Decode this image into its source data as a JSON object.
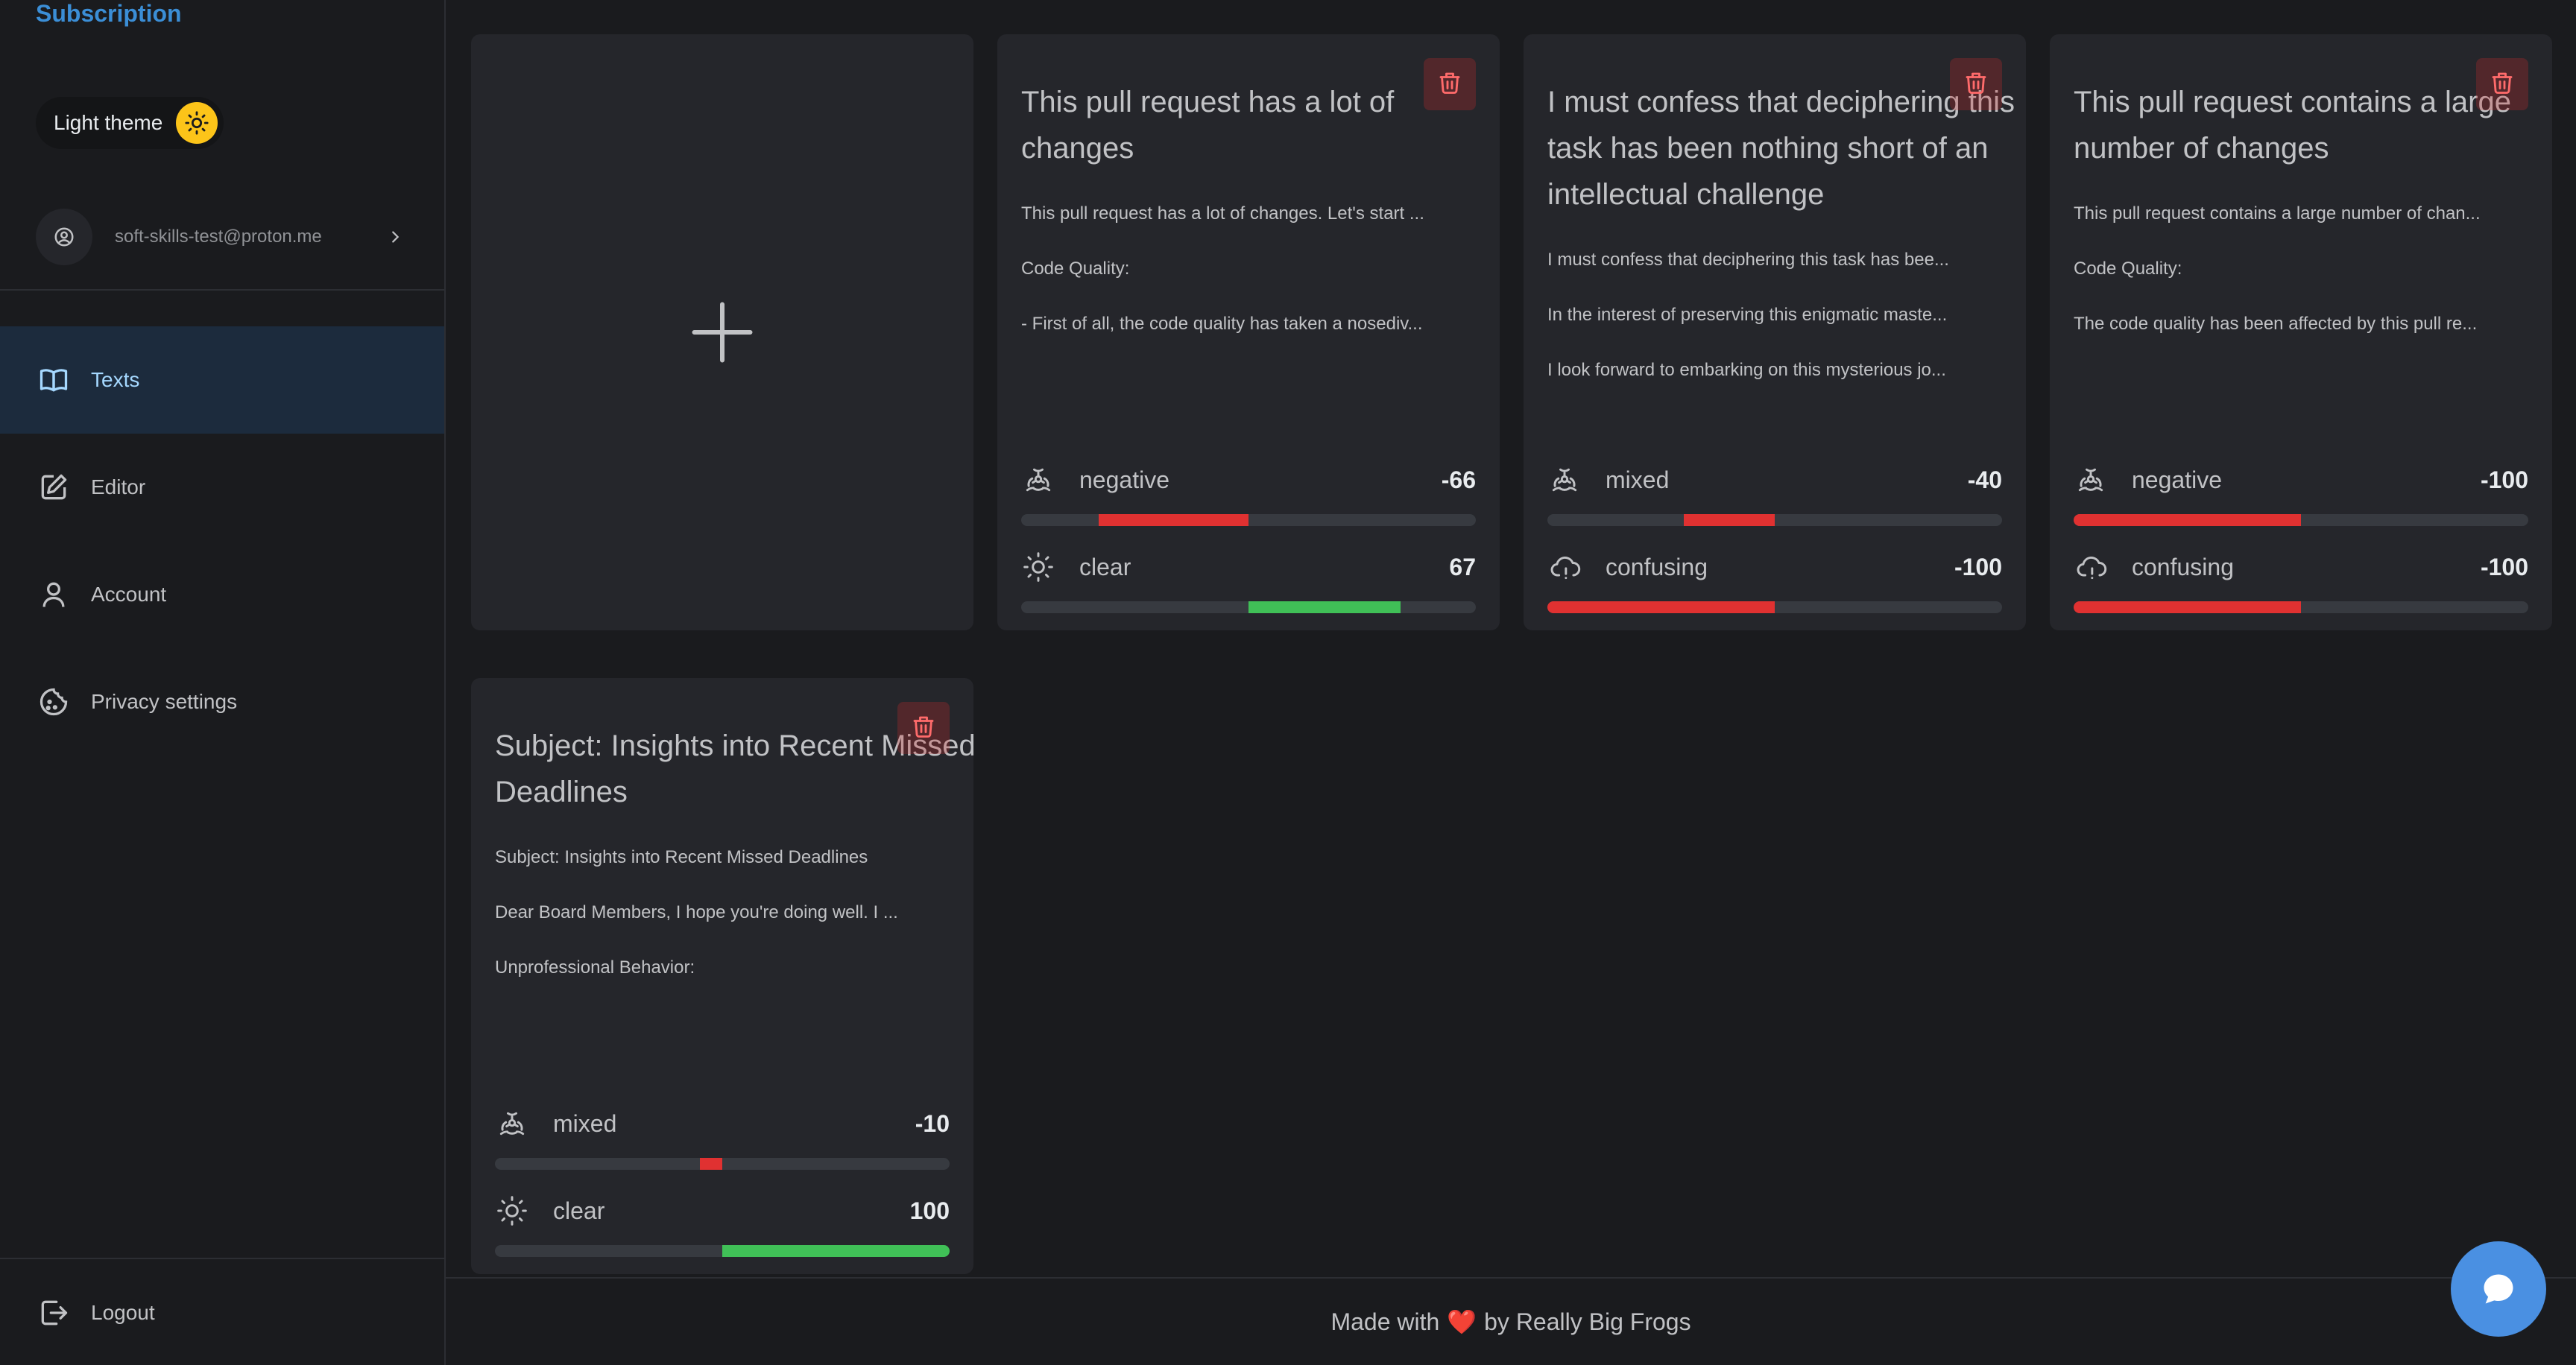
{
  "brand": {
    "label": "Subscription"
  },
  "theme_toggle": {
    "label": "Light theme",
    "icon": "sun-icon",
    "accent": "#fcc419"
  },
  "user": {
    "email": "soft-skills-test@proton.me"
  },
  "nav": {
    "items": [
      {
        "label": "Texts",
        "icon": "book-icon",
        "active": true
      },
      {
        "label": "Editor",
        "icon": "edit-icon",
        "active": false
      },
      {
        "label": "Account",
        "icon": "user-icon",
        "active": false
      },
      {
        "label": "Privacy settings",
        "icon": "cookie-icon",
        "active": false
      }
    ],
    "logout": {
      "label": "Logout",
      "icon": "logout-icon"
    }
  },
  "add_card": {
    "icon": "plus-icon"
  },
  "cards": [
    {
      "title": "This pull request has a lot of changes",
      "paragraphs": [
        "This pull request has a lot of changes. Let's start ...",
        "Code Quality:",
        "- First of all, the code quality has taken a nosediv..."
      ],
      "sentiment": {
        "label": "negative",
        "value": "-66",
        "score": -66,
        "icon": "biohazard-icon"
      },
      "clarity": {
        "label": "clear",
        "value": "67",
        "score": 67,
        "icon": "sun-icon"
      }
    },
    {
      "title": "I must confess that deciphering this task has been nothing short of an intellectual challenge",
      "paragraphs": [
        "I must confess that deciphering this task has bee...",
        "In the interest of preserving this enigmatic maste...",
        "I look forward to embarking on this mysterious jo..."
      ],
      "sentiment": {
        "label": "mixed",
        "value": "-40",
        "score": -40,
        "icon": "biohazard-icon"
      },
      "clarity": {
        "label": "confusing",
        "value": "-100",
        "score": -100,
        "icon": "cloud-alert-icon"
      }
    },
    {
      "title": "This pull request contains a large number of changes",
      "paragraphs": [
        "This pull request contains a large number of chan...",
        "Code Quality:",
        "The code quality has been affected by this pull re..."
      ],
      "sentiment": {
        "label": "negative",
        "value": "-100",
        "score": -100,
        "icon": "biohazard-icon"
      },
      "clarity": {
        "label": "confusing",
        "value": "-100",
        "score": -100,
        "icon": "cloud-alert-icon"
      }
    },
    {
      "title": "Subject: Insights into Recent Missed Deadlines",
      "paragraphs": [
        "Subject: Insights into Recent Missed Deadlines",
        "Dear Board Members, I hope you're doing well. I ...",
        "Unprofessional Behavior:"
      ],
      "sentiment": {
        "label": "mixed",
        "value": "-10",
        "score": -10,
        "icon": "biohazard-icon"
      },
      "clarity": {
        "label": "clear",
        "value": "100",
        "score": 100,
        "icon": "sun-icon"
      }
    }
  ],
  "colors": {
    "negative_bar": "#e03131",
    "positive_bar": "#40c057",
    "bar_track": "#373a40"
  },
  "footer": {
    "prefix": "Made with",
    "heart": "❤️",
    "suffix": "by Really Big Frogs"
  },
  "chat_button": {
    "icon": "chat-bubble-icon"
  }
}
